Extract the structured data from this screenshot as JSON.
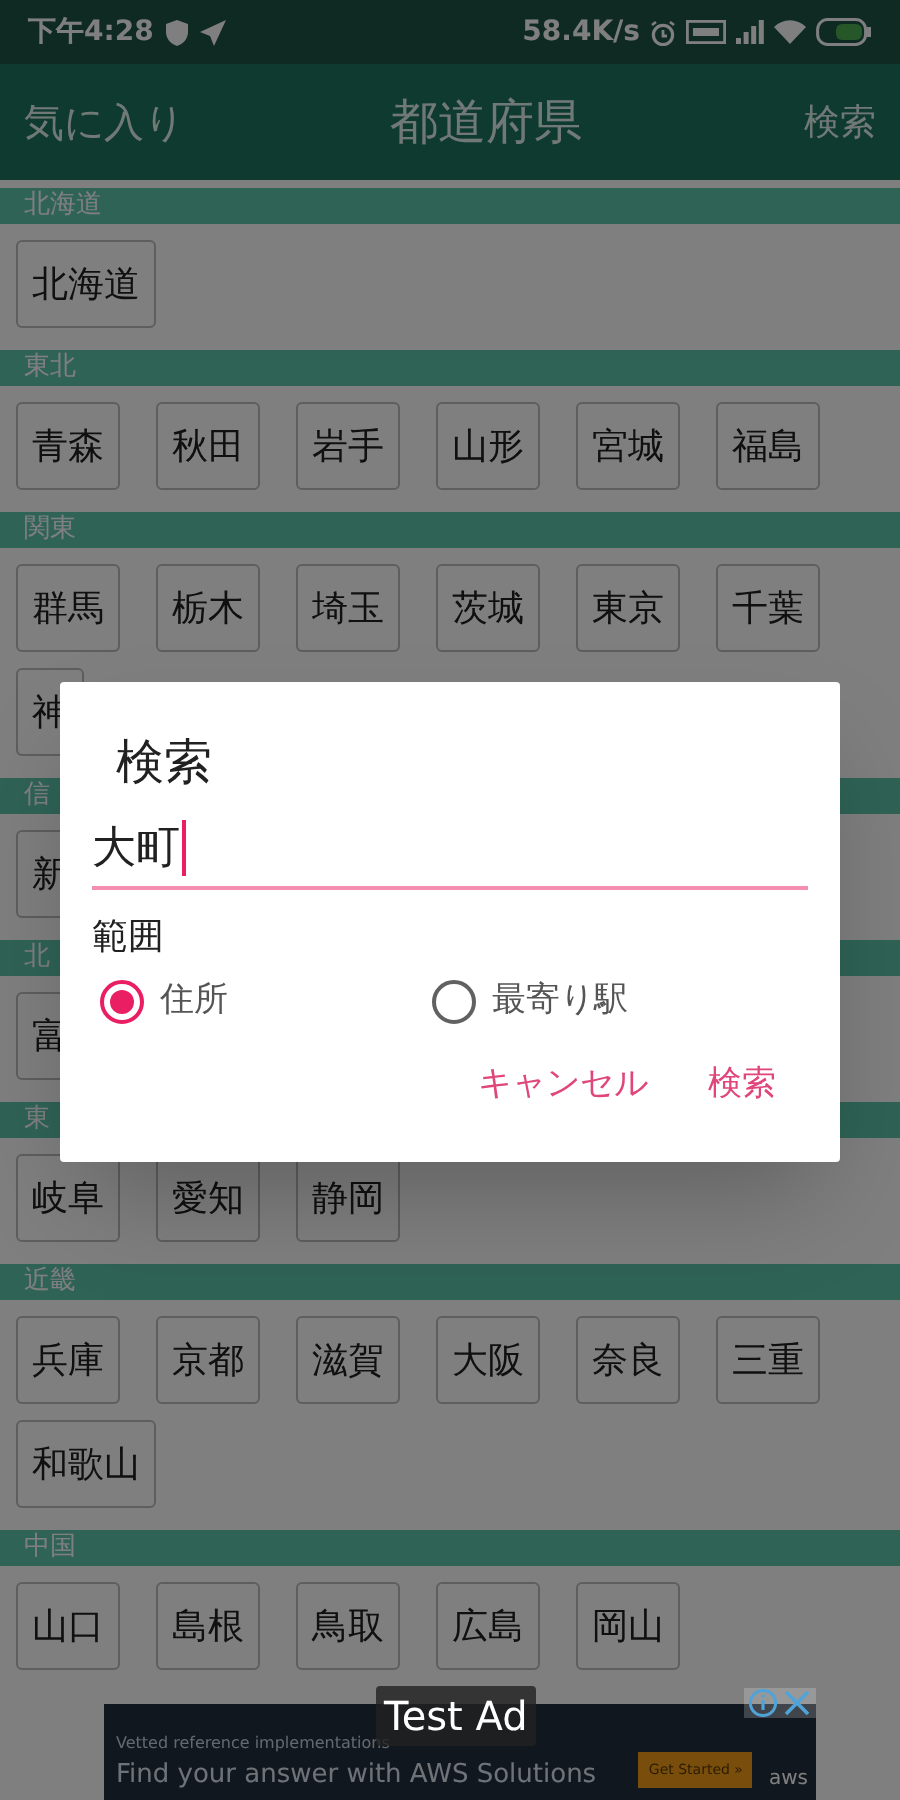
{
  "status_bar": {
    "time": "下午4:28",
    "speed": "58.4K/s"
  },
  "app_bar": {
    "favorites": "気に入り",
    "title": "都道府県",
    "search": "検索"
  },
  "sections": [
    {
      "label": "北海道",
      "items": [
        "北海道"
      ]
    },
    {
      "label": "東北",
      "items": [
        "青森",
        "秋田",
        "岩手",
        "山形",
        "宮城",
        "福島"
      ]
    },
    {
      "label": "関東",
      "items": [
        "群馬",
        "栃木",
        "埼玉",
        "茨城",
        "東京",
        "千葉",
        "神"
      ]
    },
    {
      "label": "信",
      "items": [
        "新"
      ]
    },
    {
      "label": "北",
      "items": [
        "富"
      ]
    },
    {
      "label": "東",
      "items": [
        "岐阜",
        "愛知",
        "静岡"
      ]
    },
    {
      "label": "近畿",
      "items": [
        "兵庫",
        "京都",
        "滋賀",
        "大阪",
        "奈良",
        "三重",
        "和歌山"
      ]
    },
    {
      "label": "中国",
      "items": [
        "山口",
        "島根",
        "鳥取",
        "広島",
        "岡山"
      ]
    }
  ],
  "dialog": {
    "title": "検索",
    "value": "大町",
    "range_label": "範囲",
    "options": [
      {
        "label": "住所",
        "selected": true
      },
      {
        "label": "最寄り駅",
        "selected": false
      }
    ],
    "buttons": [
      "キャンセル",
      "検索"
    ]
  },
  "ad": {
    "badge": "Test Ad",
    "tagline": "Vetted reference implementations",
    "headline": "Find your answer with AWS Solutions",
    "cta": "Get Started »",
    "brand": "aws"
  }
}
